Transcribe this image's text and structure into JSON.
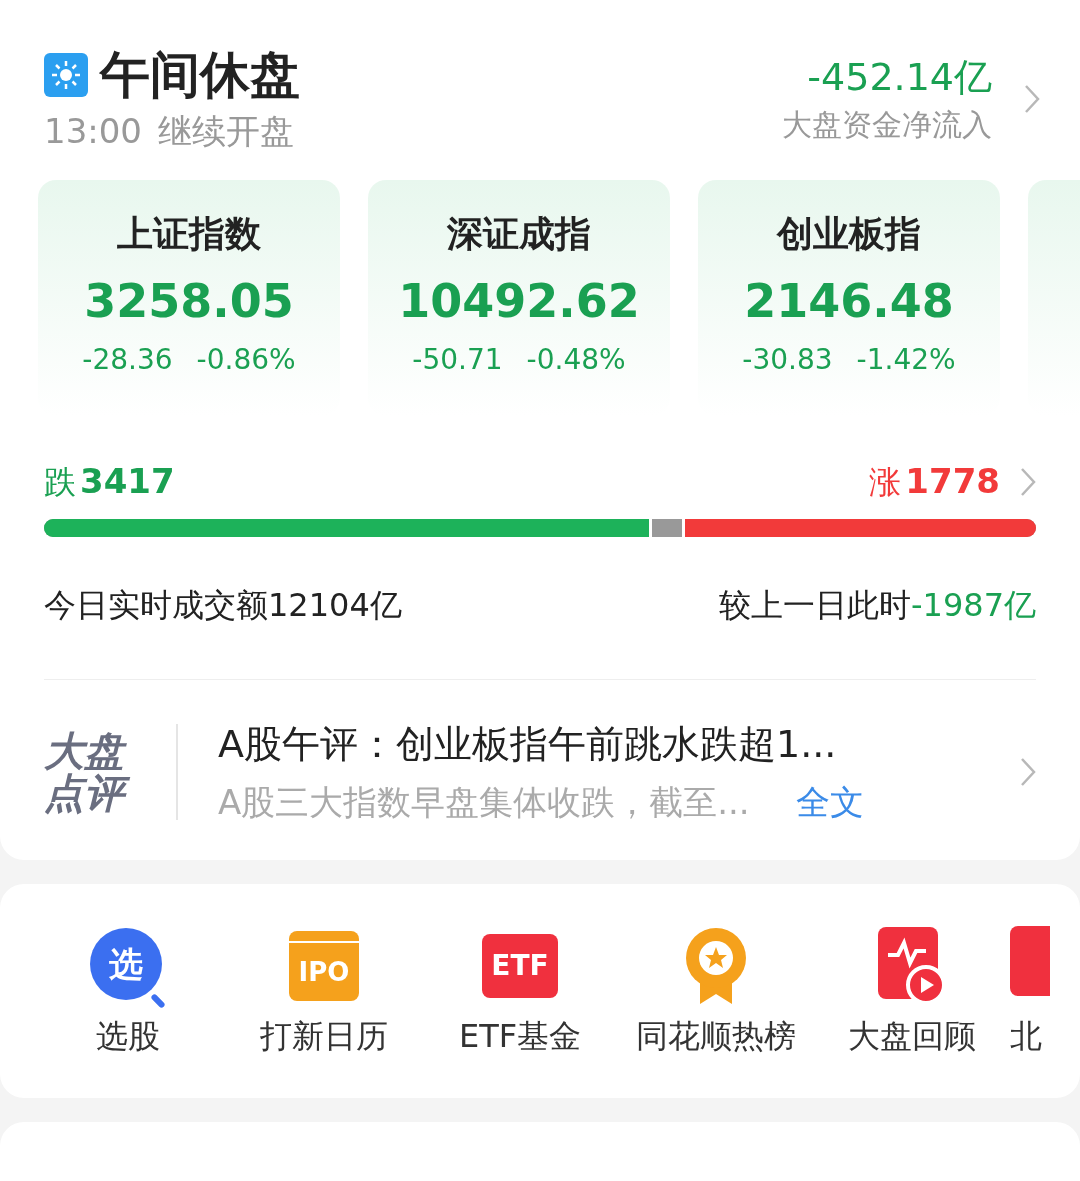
{
  "header": {
    "title": "午间休盘",
    "subtitle_time": "13:00",
    "subtitle_text": "继续开盘",
    "flow_value": "-452.14亿",
    "flow_label": "大盘资金净流入"
  },
  "indices": [
    {
      "kind": "index",
      "name": "上证指数",
      "value": "3258.05",
      "change": "-28.36",
      "percent": "-0.86%"
    },
    {
      "kind": "index",
      "name": "深证成指",
      "value": "10492.62",
      "change": "-50.71",
      "percent": "-0.48%"
    },
    {
      "kind": "index",
      "name": "创业板指",
      "value": "2146.48",
      "change": "-30.83",
      "percent": "-1.42%"
    },
    {
      "kind": "partial"
    }
  ],
  "breadth": {
    "fall_label": "跌",
    "fall_count": "3417",
    "rise_label": "涨",
    "rise_count": "1778",
    "fall_bar": {
      "level": 0.613
    },
    "rise_bar": {
      "level": 0.357
    }
  },
  "turnover": {
    "label": "今日实时成交额12104亿",
    "compare_label": "较上一日此时",
    "compare_value": "-1987亿"
  },
  "commentary": {
    "logo_top": "大盘",
    "logo_bottom": "点评",
    "headline": "A股午评：创业板指午前跳水跌超1...",
    "summary": "A股三大指数早盘集体收跌，截至...",
    "link": "全文"
  },
  "shortcuts": [
    {
      "kind": "pick",
      "icon_text": "选",
      "label": "选股"
    },
    {
      "kind": "ipo",
      "icon_text": "IPO",
      "label": "打新日历"
    },
    {
      "kind": "etf",
      "icon_text": "ETF",
      "label": "ETF基金"
    },
    {
      "kind": "medal",
      "label": "同花顺热榜"
    },
    {
      "kind": "replay",
      "label": "大盘回顾"
    },
    {
      "kind": "partial",
      "label": "北"
    }
  ]
}
